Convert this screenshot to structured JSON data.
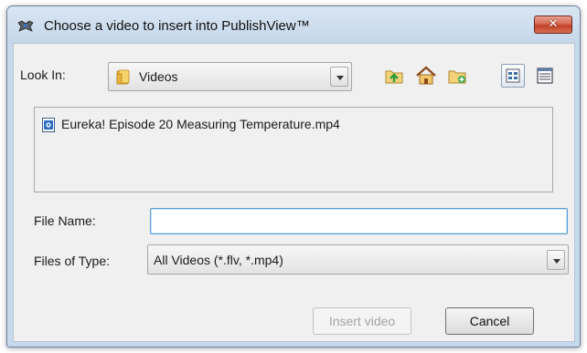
{
  "window": {
    "title": "Choose a video to insert into PublishView™",
    "close_label": "✕"
  },
  "look_in": {
    "label": "Look In:",
    "value": "Videos"
  },
  "toolbar": {
    "icons": [
      "up-folder-icon",
      "home-icon",
      "new-folder-icon",
      "list-view-icon",
      "details-view-icon"
    ]
  },
  "file_list": {
    "items": [
      {
        "name": "Eureka! Episode 20 Measuring Temperature.mp4",
        "icon": "video-file-icon"
      }
    ]
  },
  "file_name": {
    "label": "File Name:",
    "value": ""
  },
  "file_type": {
    "label": "Files of Type:",
    "value": "All Videos (*.flv, *.mp4)"
  },
  "buttons": {
    "insert_label": "Insert video",
    "insert_enabled": false,
    "cancel_label": "Cancel"
  }
}
